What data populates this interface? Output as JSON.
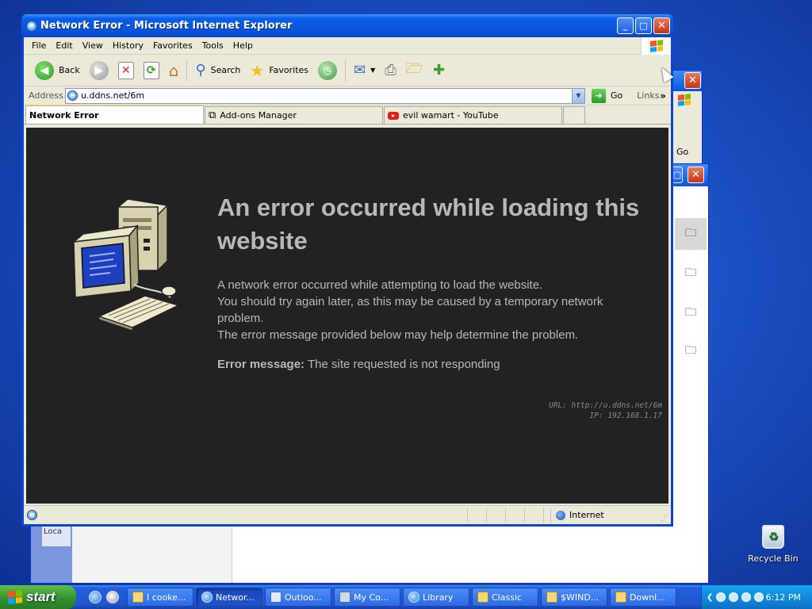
{
  "window": {
    "title": "Network Error - Microsoft Internet Explorer",
    "minimize_glyph": "_",
    "maximize_glyph": "□",
    "close_glyph": "✕"
  },
  "menu": [
    "File",
    "Edit",
    "View",
    "History",
    "Favorites",
    "Tools",
    "Help"
  ],
  "toolbar": {
    "back_label": "Back",
    "search_label": "Search",
    "favorites_label": "Favorites"
  },
  "address": {
    "label": "Address",
    "value": "u.ddns.net/6m",
    "go_label": "Go",
    "links_label": "Links"
  },
  "tabs": [
    {
      "label": "Network Error",
      "active": true
    },
    {
      "label": "Add-ons Manager",
      "active": false
    },
    {
      "label": "evil wamart - YouTube",
      "active": false
    }
  ],
  "page": {
    "title": "An error occurred while loading this website",
    "body_lines": [
      "A network error occurred while attempting to load the website.",
      "You should try again later, as this may be caused by a temporary network problem.",
      "The error message provided below may help determine the problem."
    ],
    "error_label": "Error message:",
    "error_text": "The site requested is not responding",
    "url_line": "URL: http://u.ddns.net/6m",
    "ip_line": "IP: 192.168.1.17"
  },
  "status": {
    "zone": "Internet"
  },
  "background": {
    "go_label": "Go",
    "partial_text": "Loca"
  },
  "desktop": {
    "recycle_bin": "Recycle Bin"
  },
  "taskbar": {
    "start_label": "start",
    "tasks": [
      {
        "label": "I cooke...",
        "icon": "document-icon",
        "active": false
      },
      {
        "label": "Networ...",
        "icon": "ie-icon",
        "active": true
      },
      {
        "label": "Outloo...",
        "icon": "outlook-icon",
        "active": false
      },
      {
        "label": "My Co...",
        "icon": "computer-icon",
        "active": false
      },
      {
        "label": "Library",
        "icon": "ie-icon",
        "active": false
      },
      {
        "label": "Classic",
        "icon": "folder-icon",
        "active": false
      },
      {
        "label": "$WIND...",
        "icon": "folder-icon",
        "active": false
      },
      {
        "label": "Downl...",
        "icon": "folder-icon",
        "active": false
      }
    ],
    "clock": "6:12 PM"
  },
  "colors": {
    "title_blue": "#0a54dc",
    "content_bg": "#222222",
    "content_text": "#b8b8b8",
    "start_green": "#3a9a2e"
  }
}
